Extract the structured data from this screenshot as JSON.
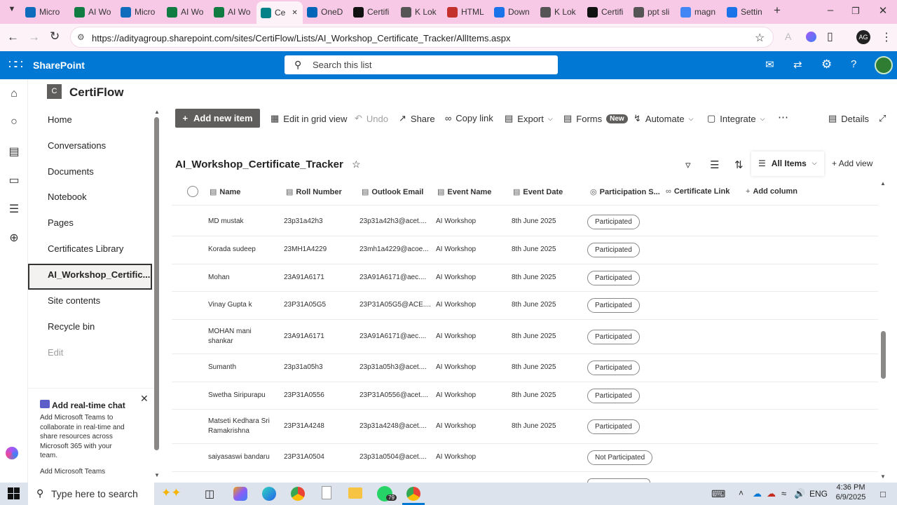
{
  "browser": {
    "tabs": [
      {
        "label": "Micro",
        "icon": "microsoft-icon",
        "color": "#0f6cbd"
      },
      {
        "label": "AI Wo",
        "icon": "excel-icon",
        "color": "#107c41"
      },
      {
        "label": "Micro",
        "icon": "microsoft-icon",
        "color": "#0f6cbd"
      },
      {
        "label": "AI Wo",
        "icon": "excel-icon",
        "color": "#107c41"
      },
      {
        "label": "AI Wo",
        "icon": "excel-icon",
        "color": "#107c41"
      },
      {
        "label": "Ce",
        "icon": "sharepoint-icon",
        "color": "#038387",
        "active": true
      },
      {
        "label": "OneD",
        "icon": "onedrive-icon",
        "color": "#0364b8"
      },
      {
        "label": "Certifi",
        "icon": "openai-icon",
        "color": "#111111"
      },
      {
        "label": "K Lok",
        "icon": "klok-icon",
        "color": "#555555"
      },
      {
        "label": "HTML",
        "icon": "html-icon",
        "color": "#c4302b"
      },
      {
        "label": "Down",
        "icon": "download-icon",
        "color": "#1a73e8"
      },
      {
        "label": "K Lok",
        "icon": "klok-icon",
        "color": "#555555"
      },
      {
        "label": "Certifi",
        "icon": "openai-icon",
        "color": "#111111"
      },
      {
        "label": "ppt sli",
        "icon": "globe-icon",
        "color": "#555555"
      },
      {
        "label": "magn",
        "icon": "google-icon",
        "color": "#4285f4"
      },
      {
        "label": "Settin",
        "icon": "settings-icon",
        "color": "#1a73e8"
      }
    ],
    "url": "https://adityagroup.sharepoint.com/sites/CertiFlow/Lists/AI_Workshop_Certificate_Tracker/AllItems.aspx"
  },
  "suite": {
    "app_name": "SharePoint",
    "search_placeholder": "Search this list"
  },
  "site": {
    "logo_letter": "C",
    "name": "CertiFlow"
  },
  "nav": {
    "items": [
      "Home",
      "Conversations",
      "Documents",
      "Notebook",
      "Pages",
      "Certificates Library",
      "AI_Workshop_Certific...",
      "Site contents",
      "Recycle bin"
    ],
    "edit_label": "Edit",
    "selected_index": 6
  },
  "promo": {
    "title": "Add real-time chat",
    "body_lines": [
      "Add Microsoft Teams to",
      "collaborate in real-time and",
      "share resources across",
      "Microsoft 365 with your",
      "team."
    ],
    "link": "Add Microsoft Teams"
  },
  "commands": {
    "add_new_item": "Add new item",
    "edit_grid": "Edit in grid view",
    "undo": "Undo",
    "share": "Share",
    "copy_link": "Copy link",
    "export": "Export",
    "forms": "Forms",
    "forms_badge": "New",
    "automate": "Automate",
    "integrate": "Integrate",
    "details": "Details"
  },
  "list": {
    "title": "AI_Workshop_Certificate_Tracker",
    "view_name": "All Items",
    "add_view": "Add view",
    "columns": [
      "Name",
      "Roll Number",
      "Outlook Email",
      "Event Name",
      "Event Date",
      "Participation S...",
      "Certificate Link",
      "Add column"
    ],
    "rows": [
      {
        "name": "MD mustak",
        "roll": "23p31a42h3",
        "email": "23p31a42h3@acet....",
        "event": "AI Workshop",
        "date": "8th June 2025",
        "status": "Participated"
      },
      {
        "name": "Korada sudeep",
        "roll": "23MH1A4229",
        "email": "23mh1a4229@acoe...",
        "event": "AI Workshop",
        "date": "8th June 2025",
        "status": "Participated"
      },
      {
        "name": "Mohan",
        "roll": "23A91A6171",
        "email": "23A91A6171@aec....",
        "event": "AI Workshop",
        "date": "8th June 2025",
        "status": "Participated"
      },
      {
        "name": "Vinay Gupta k",
        "roll": "23P31A05G5",
        "email": "23P31A05G5@ACE....",
        "event": "AI Workshop",
        "date": "8th June 2025",
        "status": "Participated"
      },
      {
        "name": "MOHAN mani",
        "name2": "shankar",
        "roll": "23A91A6171",
        "email": "23A91A6171@aec....",
        "event": "AI Workshop",
        "date": "8th June 2025",
        "status": "Participated"
      },
      {
        "name": "Sumanth",
        "roll": "23p31a05h3",
        "email": "23p31a05h3@acet....",
        "event": "AI Workshop",
        "date": "8th June 2025",
        "status": "Participated"
      },
      {
        "name": "Swetha Siripurapu",
        "roll": "23P31A0556",
        "email": "23P31A0556@acet....",
        "event": "AI Workshop",
        "date": "8th June 2025",
        "status": "Participated"
      },
      {
        "name": "Matseti Kedhara Sri",
        "name2": "Ramakrishna",
        "roll": "23P31A4248",
        "email": "23p31a4248@acet....",
        "event": "AI Workshop",
        "date": "8th June 2025",
        "status": "Participated"
      },
      {
        "name": "saiyasaswi bandaru",
        "roll": "23P31A0504",
        "email": "23p31a0504@acet....",
        "event": "AI Workshop",
        "date": "",
        "status": "Not Participated"
      }
    ]
  },
  "taskbar": {
    "search_placeholder": "Type here to search",
    "whatsapp_badge": "79",
    "lang": "ENG",
    "time": "4:36 PM",
    "date": "6/9/2025"
  },
  "colors": {
    "suite_blue": "#0078d4",
    "tab_strip": "#f7c9e6",
    "address_row": "#fdf2f8",
    "accent_gray": "#605e5c"
  }
}
